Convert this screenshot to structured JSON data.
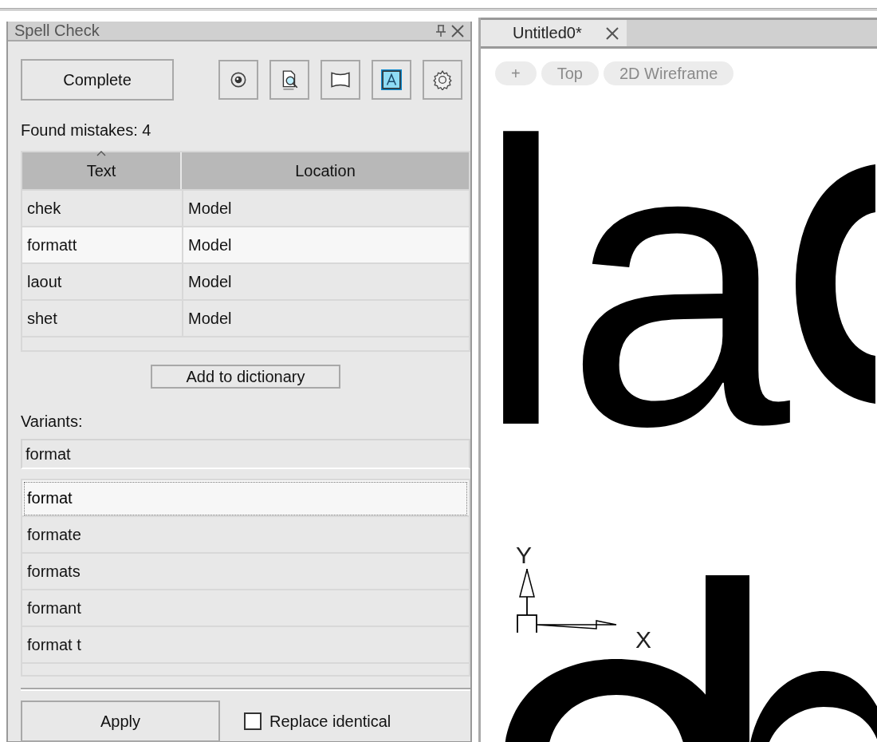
{
  "panel": {
    "title": "Spell Check",
    "complete_button": "Complete",
    "toolbar": [
      {
        "kind": "radio",
        "on": false
      },
      {
        "kind": "find",
        "on": false
      },
      {
        "kind": "frame",
        "on": false
      },
      {
        "kind": "letter",
        "on": true
      },
      {
        "kind": "gear",
        "on": false
      }
    ],
    "found_label": "Found mistakes: 4",
    "table": {
      "columns": [
        {
          "label": "Text",
          "sorted": true
        },
        {
          "label": "Location",
          "sorted": false
        }
      ],
      "rows": [
        {
          "cells": [
            "chek",
            "Model"
          ],
          "selected": false
        },
        {
          "cells": [
            "formatt",
            "Model"
          ],
          "selected": true
        },
        {
          "cells": [
            "laout",
            "Model"
          ],
          "selected": false
        },
        {
          "cells": [
            "shet",
            "Model"
          ],
          "selected": false
        }
      ]
    },
    "add_button": "Add to dictionary",
    "variants_label": "Variants:",
    "variant_field": {
      "value": "format"
    },
    "variants": [
      {
        "label": "format",
        "selected": true
      },
      {
        "label": "formate",
        "selected": false
      },
      {
        "label": "formats",
        "selected": false
      },
      {
        "label": "formant",
        "selected": false
      },
      {
        "label": "format t",
        "selected": false
      }
    ],
    "apply_button": "Apply",
    "replace_identical": {
      "label": "Replace identical",
      "checked": false
    }
  },
  "document": {
    "tabs": [
      {
        "label": "Untitled0*",
        "selected": true
      }
    ],
    "view_controls": [
      "+",
      "Top",
      "2D Wireframe"
    ],
    "canvas_text": "la",
    "axis_labels": [
      "Y",
      "X"
    ]
  }
}
